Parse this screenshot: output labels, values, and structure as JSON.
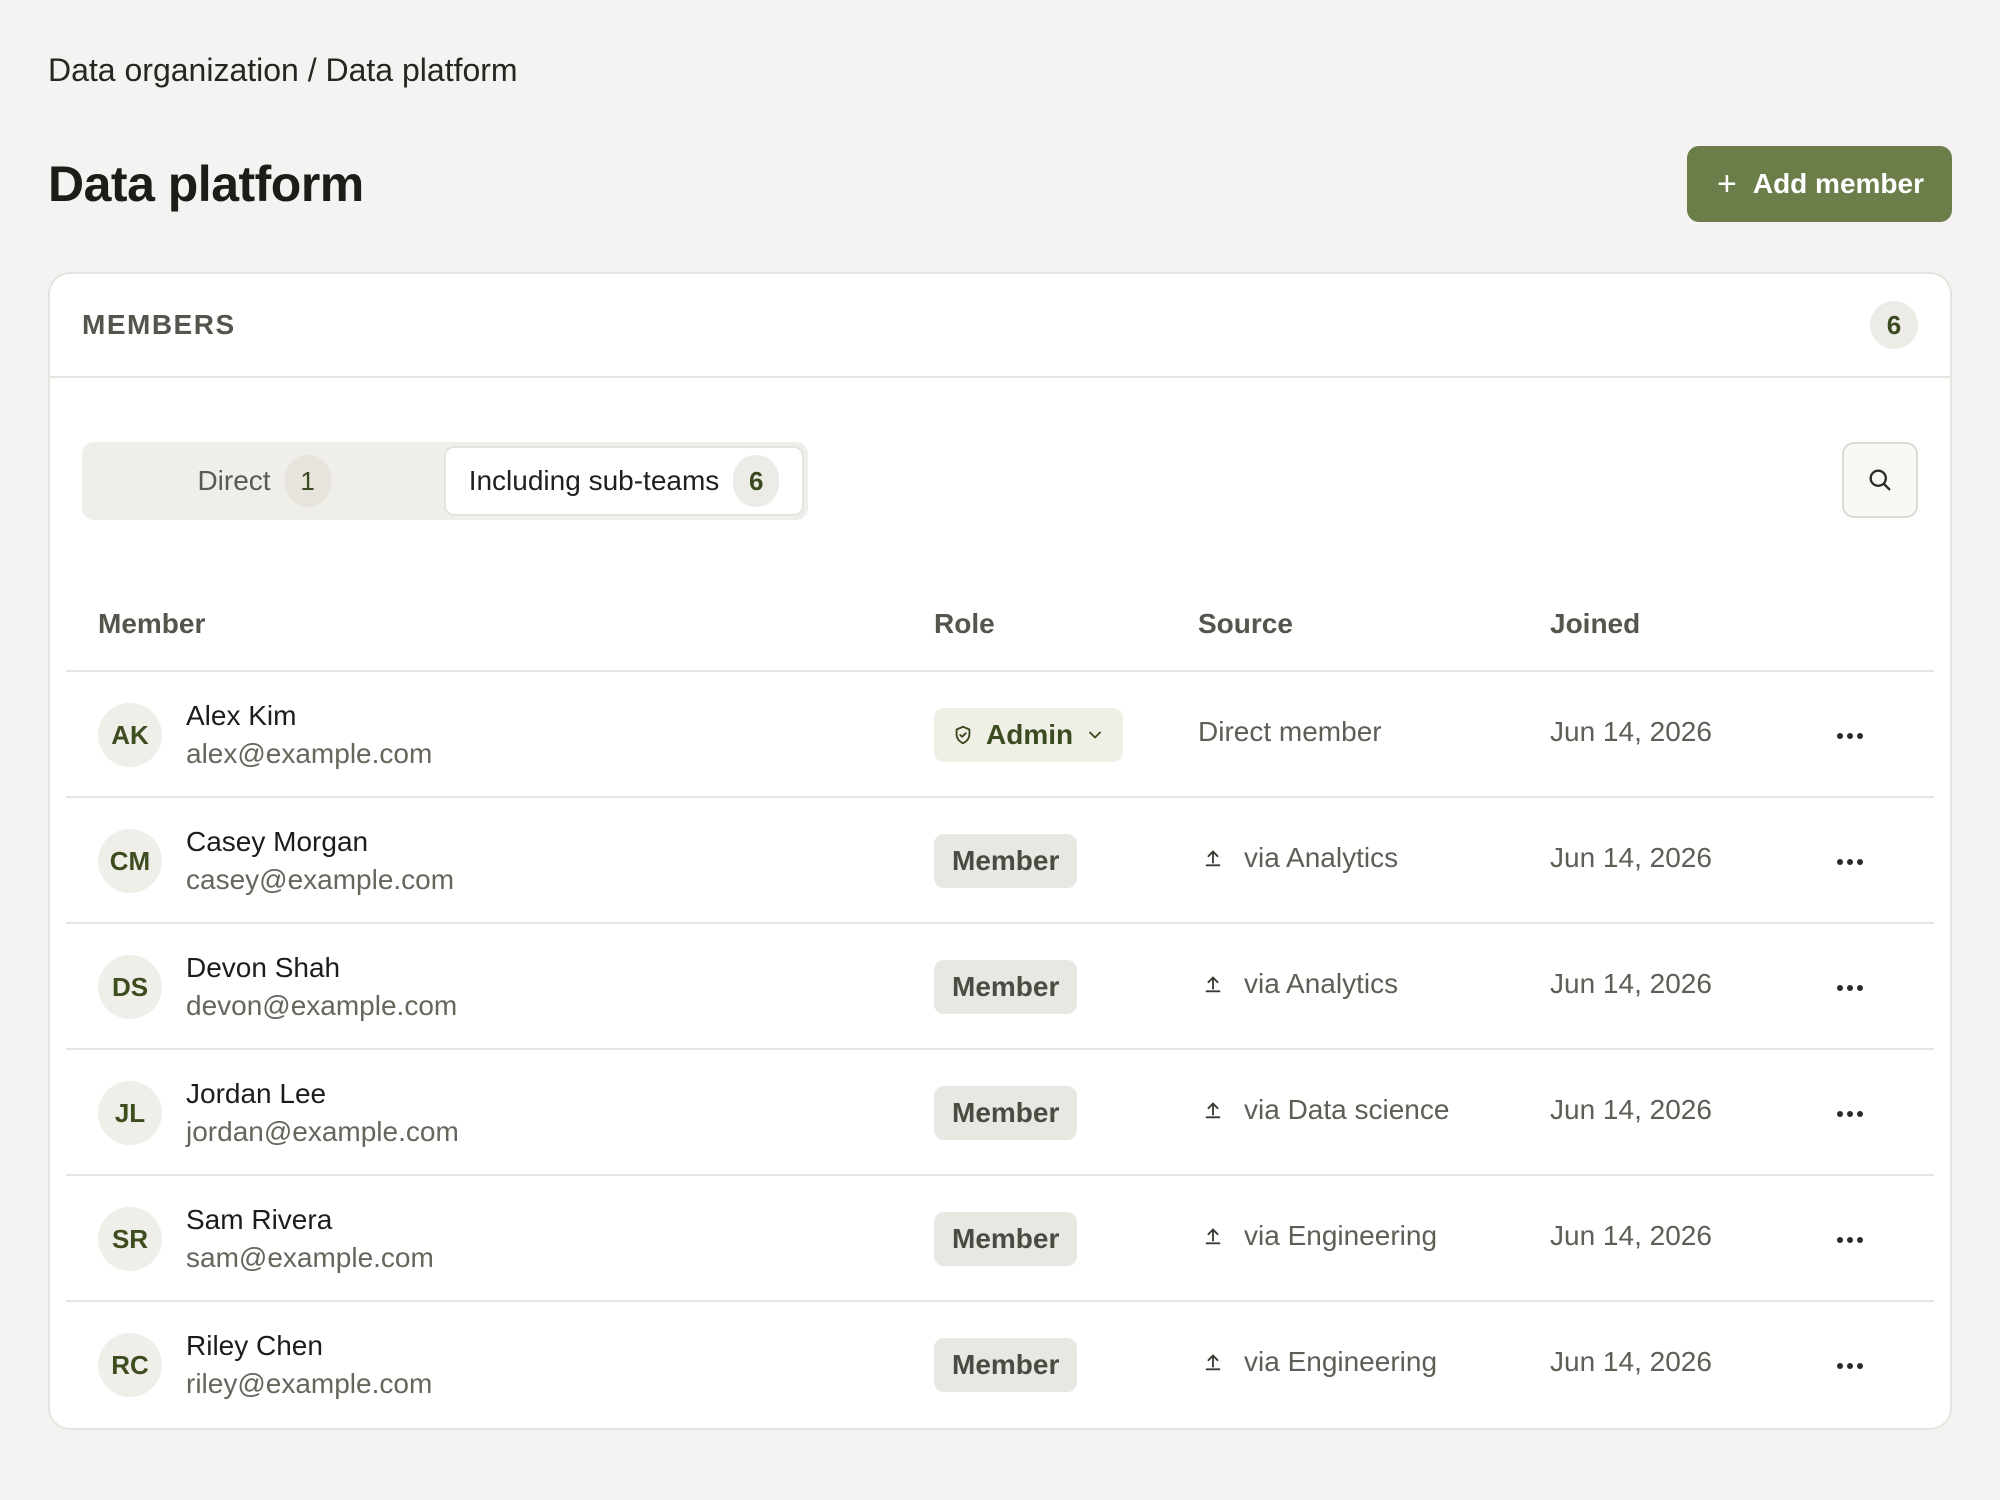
{
  "breadcrumb": {
    "parent": "Data organization",
    "separator": " / ",
    "current": "Data platform"
  },
  "page": {
    "title": "Data platform",
    "add_member_label": "Add member"
  },
  "members_card": {
    "title": "MEMBERS",
    "count": "6",
    "tabs": {
      "direct": {
        "label": "Direct",
        "count": "1"
      },
      "sub_teams": {
        "label": "Including sub-teams",
        "count": "6",
        "selected": true
      }
    },
    "search_icon": "search-icon"
  },
  "table": {
    "columns": {
      "member": "Member",
      "role": "Role",
      "source": "Source",
      "joined": "Joined"
    },
    "rows": [
      {
        "initials": "AK",
        "name": "Alex Kim",
        "email": "alex@example.com",
        "role": "Admin",
        "source": "Direct member",
        "joined": "Jun 14, 2026"
      },
      {
        "initials": "CM",
        "name": "Casey Morgan",
        "email": "casey@example.com",
        "role": "Member",
        "source": "via Analytics",
        "joined": "Jun 14, 2026"
      },
      {
        "initials": "DS",
        "name": "Devon Shah",
        "email": "devon@example.com",
        "role": "Member",
        "source": "via Analytics",
        "joined": "Jun 14, 2026"
      },
      {
        "initials": "JL",
        "name": "Jordan Lee",
        "email": "jordan@example.com",
        "role": "Member",
        "source": "via Data science",
        "joined": "Jun 14, 2026"
      },
      {
        "initials": "SR",
        "name": "Sam Rivera",
        "email": "sam@example.com",
        "role": "Member",
        "source": "via Engineering",
        "joined": "Jun 14, 2026"
      },
      {
        "initials": "RC",
        "name": "Riley Chen",
        "email": "riley@example.com",
        "role": "Member",
        "source": "via Engineering",
        "joined": "Jun 14, 2026"
      }
    ]
  },
  "colors": {
    "accent": "#6b7d48",
    "background": "#f4f3f1",
    "card": "#ffffff",
    "badge_text": "#3b4a20"
  }
}
